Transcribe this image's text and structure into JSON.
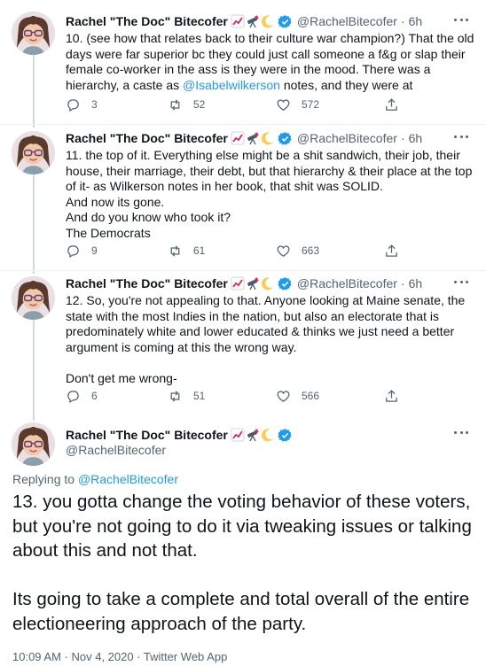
{
  "author": {
    "name": "Rachel \"The Doc\" Bitecofer",
    "handle": "@RachelBitecofer",
    "emoji_icons": [
      "chart-increasing-icon",
      "telescope-icon",
      "crescent-moon-icon"
    ],
    "verified_color": "#1d9bf0"
  },
  "colors": {
    "accent": "#1d9bf0",
    "secondary_text": "#536471",
    "thread_line": "#cfd9de"
  },
  "tweets": [
    {
      "time": "6h",
      "text_a": "10. (see how that relates back to their culture war champion?) That the old days were far superior bc they could just call someone a f&g or slap their female co-worker in the ass is they were in the mood. There was a hierarchy, a caste as ",
      "mention": "@Isabelwilkerson",
      "text_b": " notes, and they were at",
      "replies": "3",
      "retweets": "52",
      "likes": "572"
    },
    {
      "time": "6h",
      "text": "11. the top of it. Everything else might be a shit sandwich, their job, their house, their marriage, their debt, but that hierarchy & their place at the top of it- as Wilkerson notes in her book, that shit was SOLID.\nAnd now its gone.\nAnd do you know who took it?\nThe Democrats",
      "replies": "9",
      "retweets": "61",
      "likes": "663"
    },
    {
      "time": "6h",
      "text": "12. So, you're not appealing to that. Anyone looking at Maine senate, the state with the most Indies in the nation, but also an electorate that is predominately white and lower educated & thinks we just need a better argument is coming at this the wrong way.\n\nDon't get me wrong-",
      "replies": "6",
      "retweets": "51",
      "likes": "566"
    }
  ],
  "main": {
    "replying_prefix": "Replying to",
    "replying_to": "@RachelBitecofer",
    "text": "13. you gotta change the voting behavior of these voters, but you're not going to do it via tweaking issues or talking about this and not that.\n\nIts going to take a complete and total overall of the entire electioneering approach of the party.",
    "timestamp": "10:09 AM · Nov 4, 2020 · Twitter Web App"
  }
}
